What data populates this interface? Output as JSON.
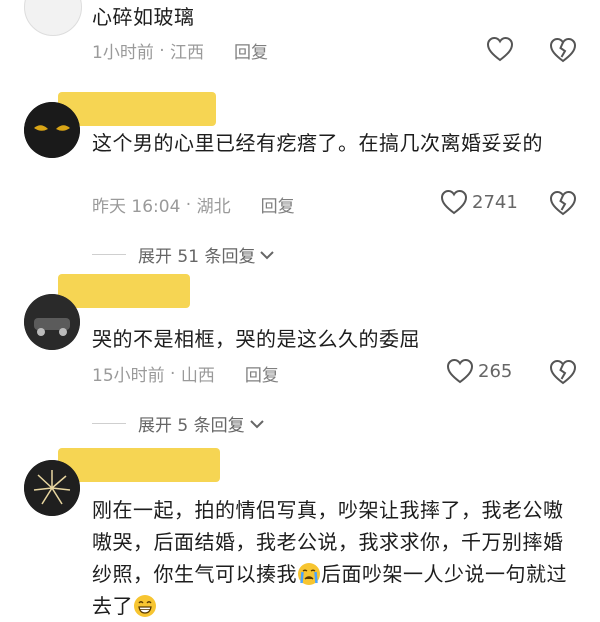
{
  "comments": [
    {
      "text": "心碎如玻璃",
      "time": "1小时前",
      "location": "江西",
      "reply_label": "回复",
      "likes": ""
    },
    {
      "text": "这个男的心里已经有疙瘩了。在搞几次离婚妥妥的",
      "time": "昨天 16:04",
      "location": "湖北",
      "reply_label": "回复",
      "likes": "2741",
      "expand_label": "展开 51 条回复"
    },
    {
      "text": "哭的不是相框，哭的是这么久的委屈",
      "time": "15小时前",
      "location": "山西",
      "reply_label": "回复",
      "likes": "265",
      "expand_label": "展开 5 条回复"
    },
    {
      "text_part1": "刚在一起，拍的情侣写真，吵架让我摔了，我老公嗷嗷哭，后面结婚，我老公说，我求求你，千万别摔婚纱照，你生气可以揍我",
      "text_part2": "后面吵架一人少说一句就过去了",
      "emoji1": "crying-face",
      "emoji2": "grinning-face"
    }
  ],
  "colors": {
    "highlight": "#f6d34a",
    "meta_gray": "#9a9a9a",
    "text": "#1d1d1d"
  }
}
